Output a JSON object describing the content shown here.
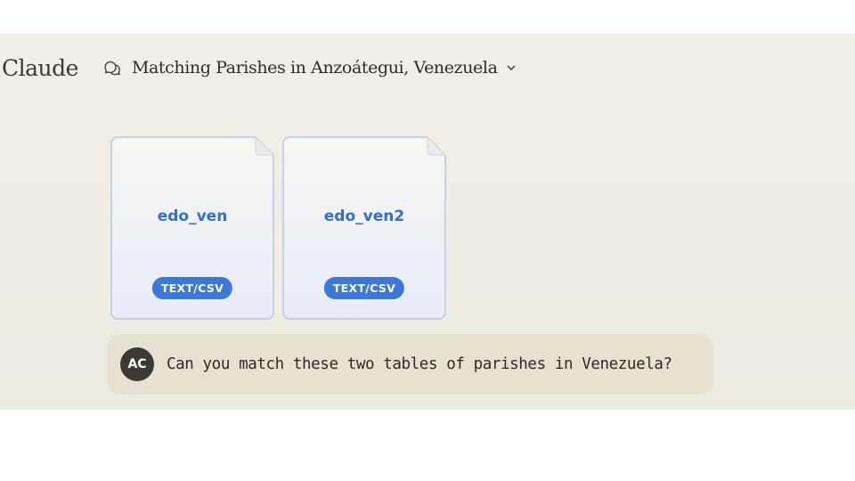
{
  "app": {
    "brand": "Claude"
  },
  "header": {
    "chat_icon": "chat-bubbles-icon",
    "title": "Matching Parishes in Anzoátegui, Venezuela",
    "chevron_icon": "chevron-down-icon"
  },
  "attachments": [
    {
      "name": "edo_ven",
      "type": "TEXT/CSV"
    },
    {
      "name": "edo_ven2",
      "type": "TEXT/CSV"
    }
  ],
  "message": {
    "avatar_initials": "AC",
    "text": "Can you match these two tables of parishes in Venezuela?"
  },
  "colors": {
    "background": "#f1efe7",
    "file_name": "#2f6fd6",
    "badge": "#3b78d8",
    "message_bubble": "#e7e1d2",
    "avatar": "#3d3a35"
  }
}
